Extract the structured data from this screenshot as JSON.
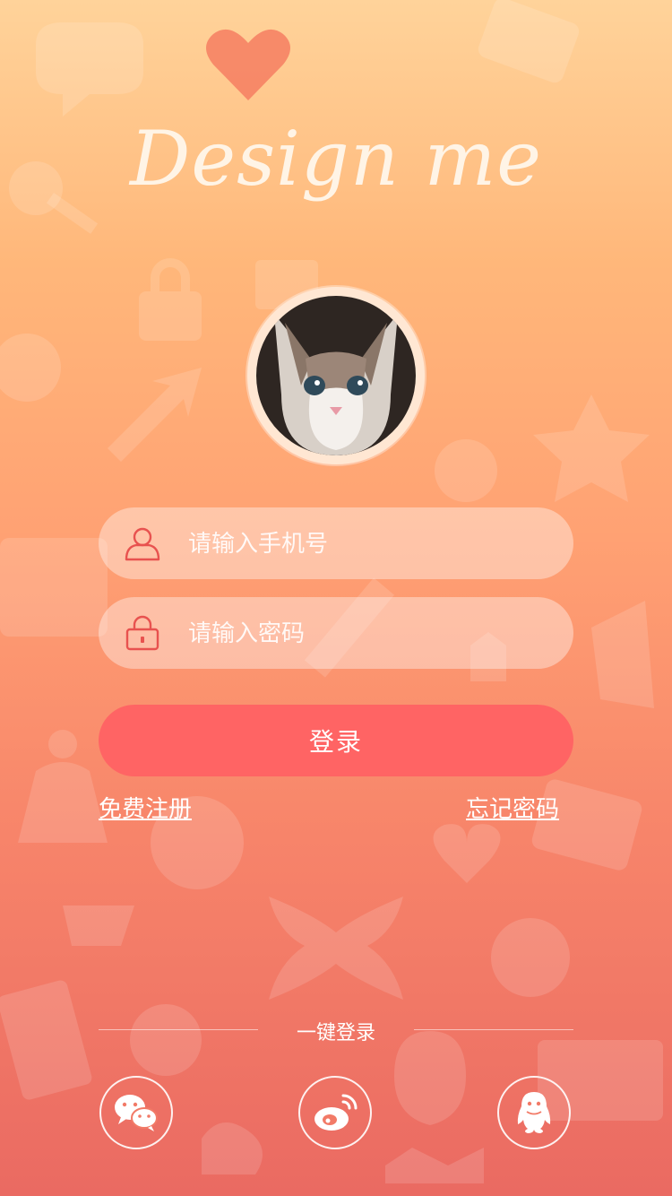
{
  "logo": {
    "text": "Design me",
    "heart_icon": "heart-icon"
  },
  "avatar": {
    "icon": "cat-avatar"
  },
  "phone_field": {
    "placeholder": "请输入手机号",
    "value": "",
    "icon": "user-icon"
  },
  "password_field": {
    "placeholder": "请输入密码",
    "value": "",
    "icon": "lock-icon"
  },
  "login_button": {
    "label": "登录"
  },
  "links": {
    "register": "免费注册",
    "forgot": "忘记密码"
  },
  "social_login": {
    "title": "一键登录",
    "providers": [
      {
        "name": "wechat",
        "icon": "wechat-icon"
      },
      {
        "name": "weibo",
        "icon": "weibo-icon"
      },
      {
        "name": "qq",
        "icon": "qq-icon"
      }
    ]
  },
  "colors": {
    "accent": "#ff6464",
    "icon_red": "#e8524f",
    "gradient_top": "#ffd39a",
    "gradient_bottom": "#ea6a62"
  }
}
